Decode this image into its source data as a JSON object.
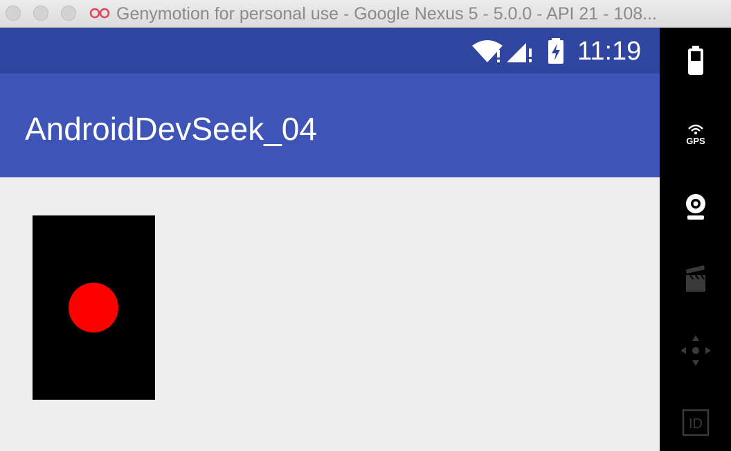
{
  "window": {
    "title": "Genymotion for personal use - Google Nexus 5 - 5.0.0 - API 21 - 108...",
    "logo": "genymotion-logo-icon"
  },
  "status_bar": {
    "time": "11:19",
    "icons": [
      "wifi-icon",
      "cell-signal-icon",
      "battery-charging-icon"
    ],
    "color": "#2f45a0"
  },
  "app_bar": {
    "title": "AndroidDevSeek_04",
    "color": "#3e54b6"
  },
  "custom_view": {
    "background": "#000000",
    "dot_color": "#ff0000"
  },
  "toolbar": {
    "items": [
      {
        "name": "battery-icon"
      },
      {
        "name": "gps-icon",
        "label": "GPS"
      },
      {
        "name": "webcam-icon"
      },
      {
        "name": "screen-capture-icon"
      },
      {
        "name": "dpad-icon"
      },
      {
        "name": "device-id-icon",
        "label": "ID"
      }
    ]
  }
}
